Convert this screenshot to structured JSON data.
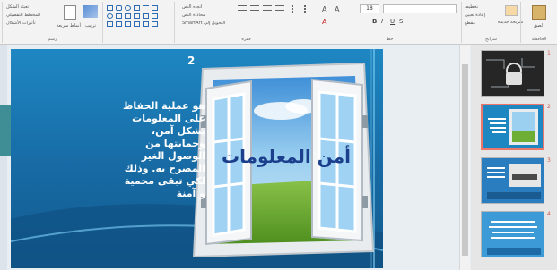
{
  "ribbon": {
    "groups": {
      "slides": {
        "label": "شرائح",
        "new_slide": "شريحة جديدة",
        "layout": "تخطيط",
        "reset": "إعادة تعيين",
        "section": "مقطع"
      },
      "clipboard": {
        "label": "الحافظة",
        "paste": "لصق"
      },
      "font": {
        "label": "خط",
        "font_size": "18"
      },
      "paragraph": {
        "label": "فقرة",
        "text_direction": "اتجاه النص",
        "align_text": "محاذاة النص",
        "smartart": "التحويل إلى SmartArt"
      },
      "drawing": {
        "label": "رسم",
        "arrange": "ترتيب",
        "quick_styles": "أنماط سريعة",
        "shape_fill": "تعبئة الشكل",
        "shape_outline": "المخطط التفصيلي",
        "shape_effects": "تأثيرات الأشكال"
      }
    }
  },
  "slide": {
    "number": "2",
    "body_text": "هو عملية الحفاظ على المعلومات بشكل آمن، وحمايتها من الوصول الغير المصرح به. وذلك لكي تبقى محمية و آمنة",
    "window_title": "أمن المعلومات"
  },
  "thumbnails": [
    {
      "number": "1",
      "selected": false
    },
    {
      "number": "2",
      "selected": true
    },
    {
      "number": "3",
      "selected": false
    },
    {
      "number": "4",
      "selected": false
    }
  ],
  "colors": {
    "slide_bg": "#1b7fbf",
    "accent": "#e9776b",
    "title_blue": "#1b3f8c"
  }
}
